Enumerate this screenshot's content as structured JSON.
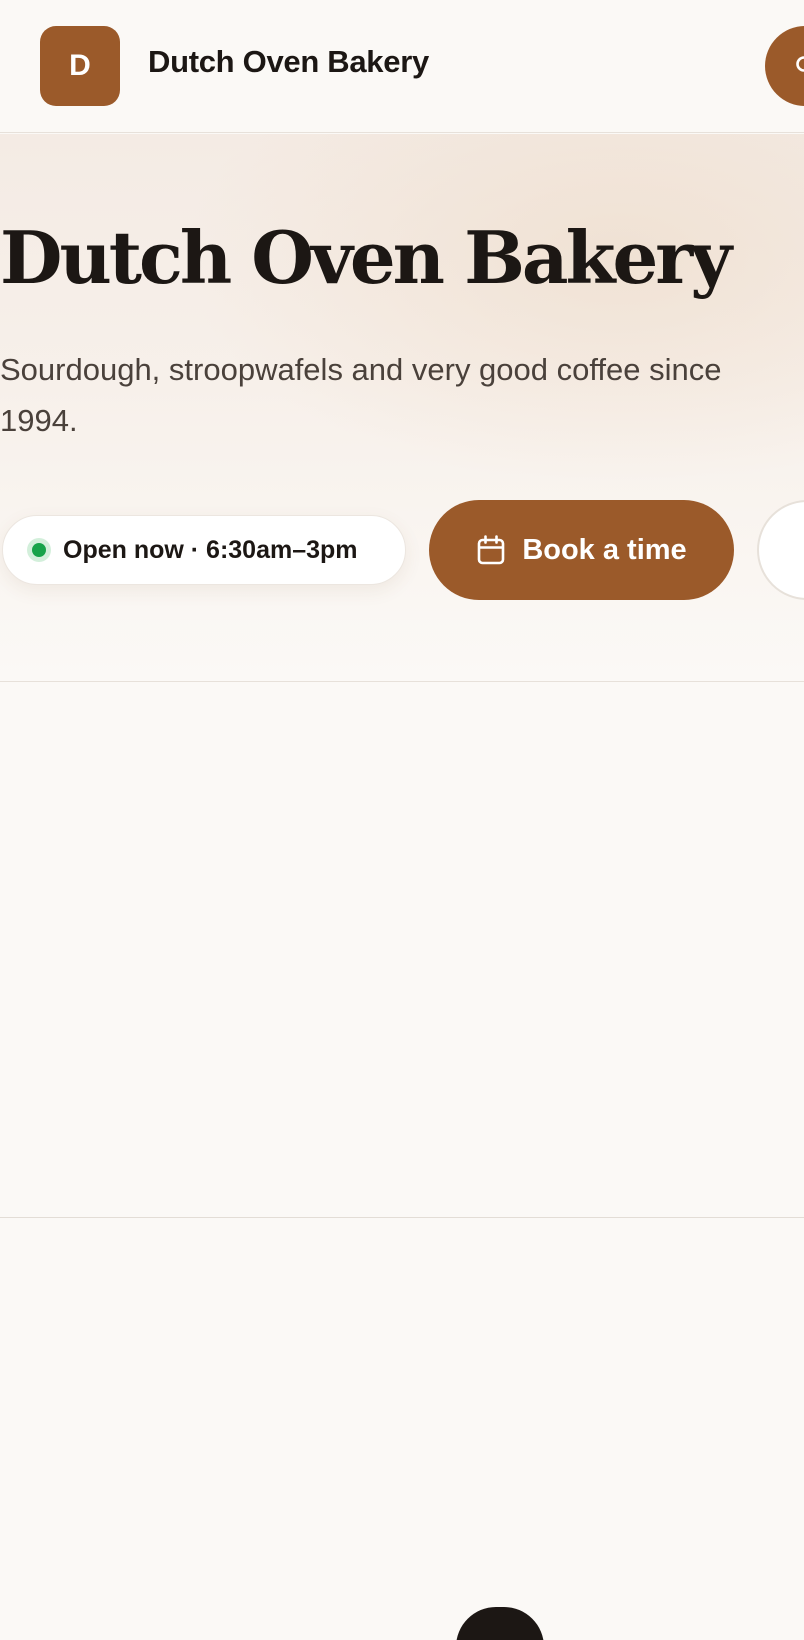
{
  "header": {
    "logo_letter": "D",
    "brand_name": "Dutch Oven Bakery",
    "action_icon": "search-icon"
  },
  "hero": {
    "title": "Dutch Oven Bakery",
    "subtitle": "Sourdough, stroopwafels and very good coffee since 1994.",
    "status": {
      "text": "Open now · 6:30am–3pm",
      "color": "#17a34a"
    },
    "book_button": {
      "label": "Book a time",
      "icon": "calendar-icon"
    }
  },
  "colors": {
    "brand": "#9b5a2a",
    "background": "#fbf9f6",
    "text": "#1c1714"
  }
}
